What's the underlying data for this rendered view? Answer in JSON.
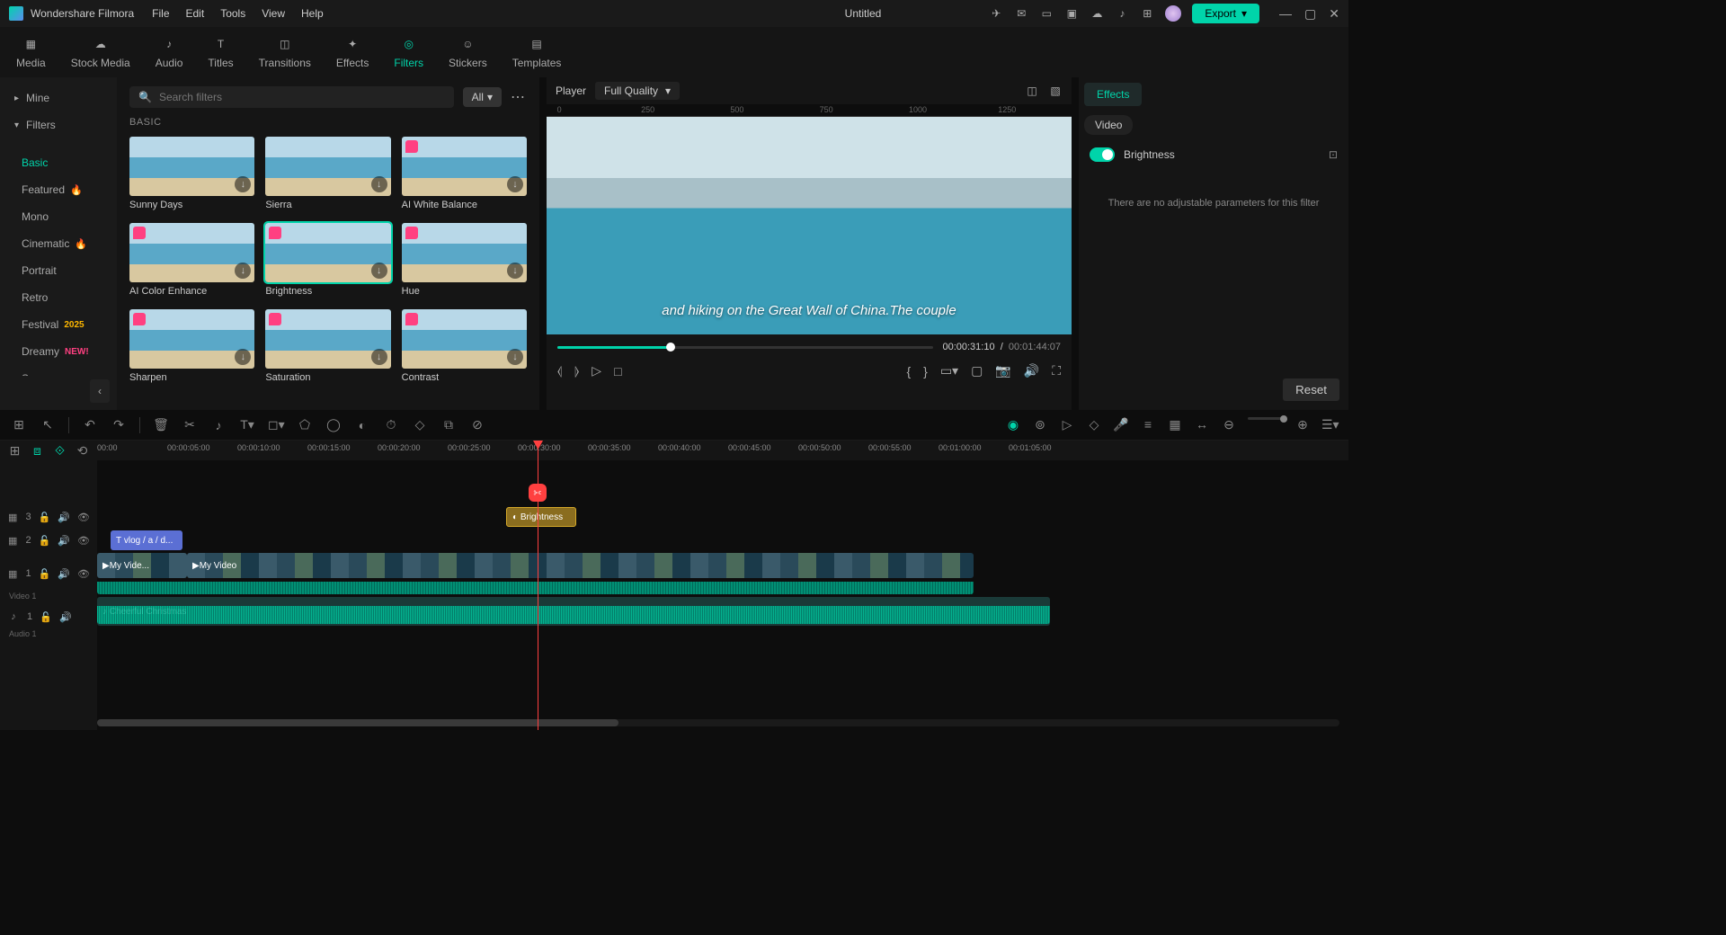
{
  "app": {
    "name": "Wondershare Filmora",
    "title": "Untitled",
    "export": "Export"
  },
  "menu": [
    "File",
    "Edit",
    "Tools",
    "View",
    "Help"
  ],
  "tabs": [
    {
      "id": "media",
      "label": "Media"
    },
    {
      "id": "stock",
      "label": "Stock Media"
    },
    {
      "id": "audio",
      "label": "Audio"
    },
    {
      "id": "titles",
      "label": "Titles"
    },
    {
      "id": "transitions",
      "label": "Transitions"
    },
    {
      "id": "effects",
      "label": "Effects"
    },
    {
      "id": "filters",
      "label": "Filters",
      "active": true
    },
    {
      "id": "stickers",
      "label": "Stickers"
    },
    {
      "id": "templates",
      "label": "Templates"
    }
  ],
  "sidebar": {
    "mine": "Mine",
    "filters": "Filters",
    "cats": [
      {
        "label": "Basic",
        "active": true
      },
      {
        "label": "Featured",
        "fire": true
      },
      {
        "label": "Mono"
      },
      {
        "label": "Cinematic",
        "fire": true
      },
      {
        "label": "Portrait"
      },
      {
        "label": "Retro"
      },
      {
        "label": "Festival",
        "year": "2025"
      },
      {
        "label": "Dreamy",
        "new": "NEW!"
      },
      {
        "label": "Scenery"
      }
    ]
  },
  "search": {
    "placeholder": "Search filters",
    "all": "All"
  },
  "section": "BASIC",
  "filters": [
    {
      "label": "Sunny Days"
    },
    {
      "label": "Sierra"
    },
    {
      "label": "AI White Balance",
      "heart": true
    },
    {
      "label": "AI Color Enhance",
      "heart": true
    },
    {
      "label": "Brightness",
      "heart": true,
      "selected": true
    },
    {
      "label": "Hue",
      "heart": true
    },
    {
      "label": "Sharpen",
      "heart": true
    },
    {
      "label": "Saturation",
      "heart": true
    },
    {
      "label": "Contrast",
      "heart": true
    }
  ],
  "player": {
    "label": "Player",
    "quality": "Full Quality",
    "subtitle": "and hiking on the Great Wall of China.The couple",
    "current": "00:00:31:10",
    "total": "00:01:44:07",
    "ruler": [
      "0",
      "250",
      "500",
      "750",
      "1000",
      "1250"
    ]
  },
  "effects": {
    "tab": "Effects",
    "subtab": "Video",
    "name": "Brightness",
    "msg": "There are no adjustable parameters for this filter",
    "reset": "Reset"
  },
  "timeline": {
    "ticks": [
      "00:00",
      "00:00:05:00",
      "00:00:10:00",
      "00:00:15:00",
      "00:00:20:00",
      "00:00:25:00",
      "00:00:30:00",
      "00:00:35:00",
      "00:00:40:00",
      "00:00:45:00",
      "00:00:50:00",
      "00:00:55:00",
      "00:01:00:00",
      "00:01:05:00"
    ],
    "tracks": {
      "t3": "3",
      "t2": "2",
      "t1": "1",
      "video": "Video 1",
      "a1": "1",
      "audio": "Audio 1"
    },
    "clips": {
      "filter": "Brightness",
      "text": "vlog / a / d...",
      "video1": "My Vide...",
      "video2": "My Video",
      "audio": "Cheerful Christmas"
    }
  }
}
